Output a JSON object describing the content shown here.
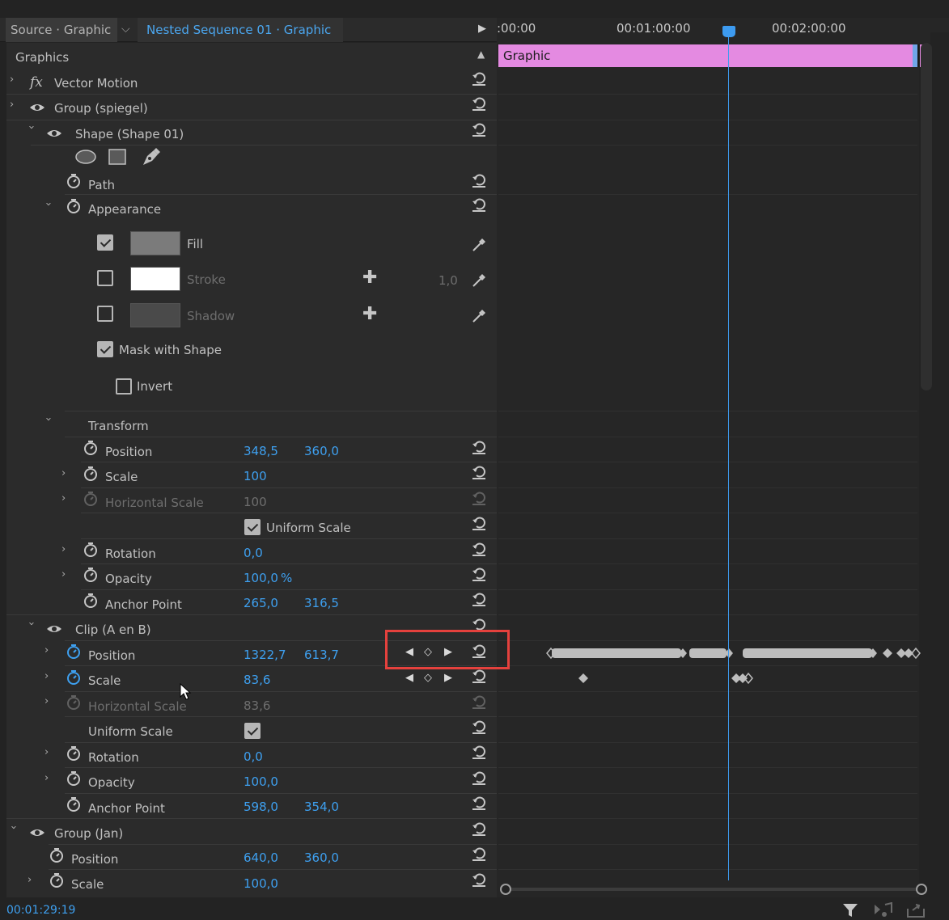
{
  "header": {
    "tab_source": "Source · Graphic",
    "tab_nested": "Nested Sequence 01 · Graphic"
  },
  "ruler": {
    "tc0": ":00:00",
    "tc1": "00:01:00:00",
    "tc2": "00:02:00:00"
  },
  "clip": {
    "label": "Graphic"
  },
  "panel": {
    "title": "Graphics"
  },
  "rows": {
    "vector_motion": "Vector Motion",
    "group_spiegel": "Group (spiegel)",
    "shape01": "Shape (Shape 01)",
    "path": "Path",
    "appearance": "Appearance",
    "fill": "Fill",
    "stroke": "Stroke",
    "stroke_width": "1,0",
    "shadow": "Shadow",
    "mask": "Mask with Shape",
    "invert": "Invert",
    "transform": "Transform",
    "t_position": "Position",
    "t_position_x": "348,5",
    "t_position_y": "360,0",
    "t_scale": "Scale",
    "t_scale_val": "100",
    "t_hscale": "Horizontal Scale",
    "t_hscale_val": "100",
    "t_uniform": "Uniform Scale",
    "t_rotation": "Rotation",
    "t_rotation_val": "0,0",
    "t_opacity": "Opacity",
    "t_opacity_val": "100,0",
    "t_opacity_unit": "%",
    "t_anchor": "Anchor Point",
    "t_anchor_x": "265,0",
    "t_anchor_y": "316,5",
    "clip_aenb": "Clip (A en B)",
    "c_position": "Position",
    "c_position_x": "1322,7",
    "c_position_y": "613,7",
    "c_scale": "Scale",
    "c_scale_val": "83,6",
    "c_hscale": "Horizontal Scale",
    "c_hscale_val": "83,6",
    "c_uniform": "Uniform Scale",
    "c_rotation": "Rotation",
    "c_rotation_val": "0,0",
    "c_opacity": "Opacity",
    "c_opacity_val": "100,0",
    "c_anchor": "Anchor Point",
    "c_anchor_x": "598,0",
    "c_anchor_y": "354,0",
    "group_jan": "Group (Jan)",
    "j_position": "Position",
    "j_position_x": "640,0",
    "j_position_y": "360,0",
    "j_scale": "Scale",
    "j_scale_val": "100,0"
  },
  "footer": {
    "timecode": "00:01:29:19"
  },
  "colors": {
    "accent": "#3ea0f0",
    "clip": "#e48ae1",
    "highlight": "#e5413d"
  }
}
